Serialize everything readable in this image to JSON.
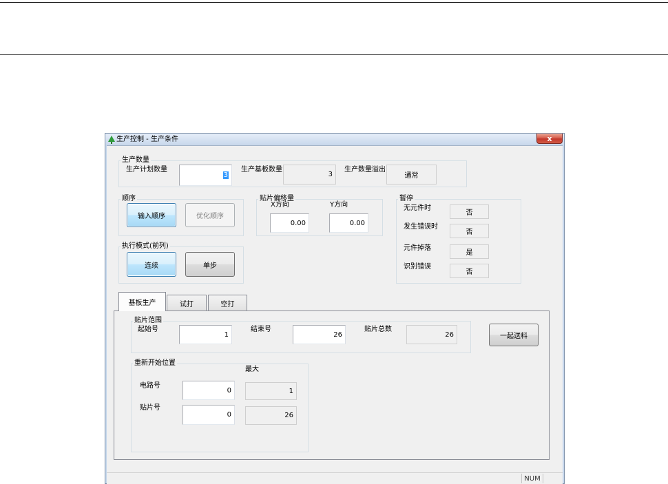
{
  "window": {
    "title": "生产控制 - 生产条件",
    "close_glyph": "x",
    "app_icon": "app-icon",
    "close_icon": "close-icon"
  },
  "production_count": {
    "group_label": "生产数量",
    "planned": {
      "label": "生产计划数量",
      "value": "3"
    },
    "produced_boards": {
      "label": "生产基板数量",
      "value": "3"
    },
    "overflow": {
      "label": "生产数量溢出",
      "value": "通常"
    }
  },
  "sequence": {
    "group_label": "顺序",
    "input_order_button": "输入顺序",
    "optimize_order_button": "优化顺序"
  },
  "placement_offset": {
    "group_label": "贴片偏移量",
    "x": {
      "label": "X方向",
      "value": "0.00"
    },
    "y": {
      "label": "Y方向",
      "value": "0.00"
    }
  },
  "pause": {
    "group_label": "暂停",
    "rows": [
      {
        "label": "无元件时",
        "value": "否"
      },
      {
        "label": "发生错误时",
        "value": "否"
      },
      {
        "label": "元件掉落",
        "value": "是"
      },
      {
        "label": "识别错误",
        "value": "否"
      }
    ]
  },
  "exec_mode": {
    "group_label": "执行模式(前列)",
    "continuous_button": "连续",
    "single_step_button": "单步"
  },
  "tabs": {
    "items": [
      {
        "label": "基板生产",
        "active": true
      },
      {
        "label": "试打",
        "active": false
      },
      {
        "label": "空打",
        "active": false
      }
    ]
  },
  "placement_range": {
    "group_label": "贴片范围",
    "start": {
      "label": "起始号",
      "value": "1"
    },
    "end": {
      "label": "结束号",
      "value": "26"
    },
    "total": {
      "label": "贴片总数",
      "value": "26"
    }
  },
  "feed_all_button": "一起送料",
  "restart_position": {
    "group_label": "重新开始位置",
    "max_header": "最大",
    "circuit": {
      "label": "电路号",
      "value": "0",
      "max": "1"
    },
    "placement": {
      "label": "贴片号",
      "value": "0",
      "max": "26"
    }
  },
  "status_bar": {
    "num_indicator": "NUM"
  },
  "colors": {
    "titlebar": "#c7d7eb",
    "close_button": "#c3372c",
    "active_button": "#bee6fd",
    "selection": "#3399ff",
    "window_background": "#f0f0f0"
  }
}
